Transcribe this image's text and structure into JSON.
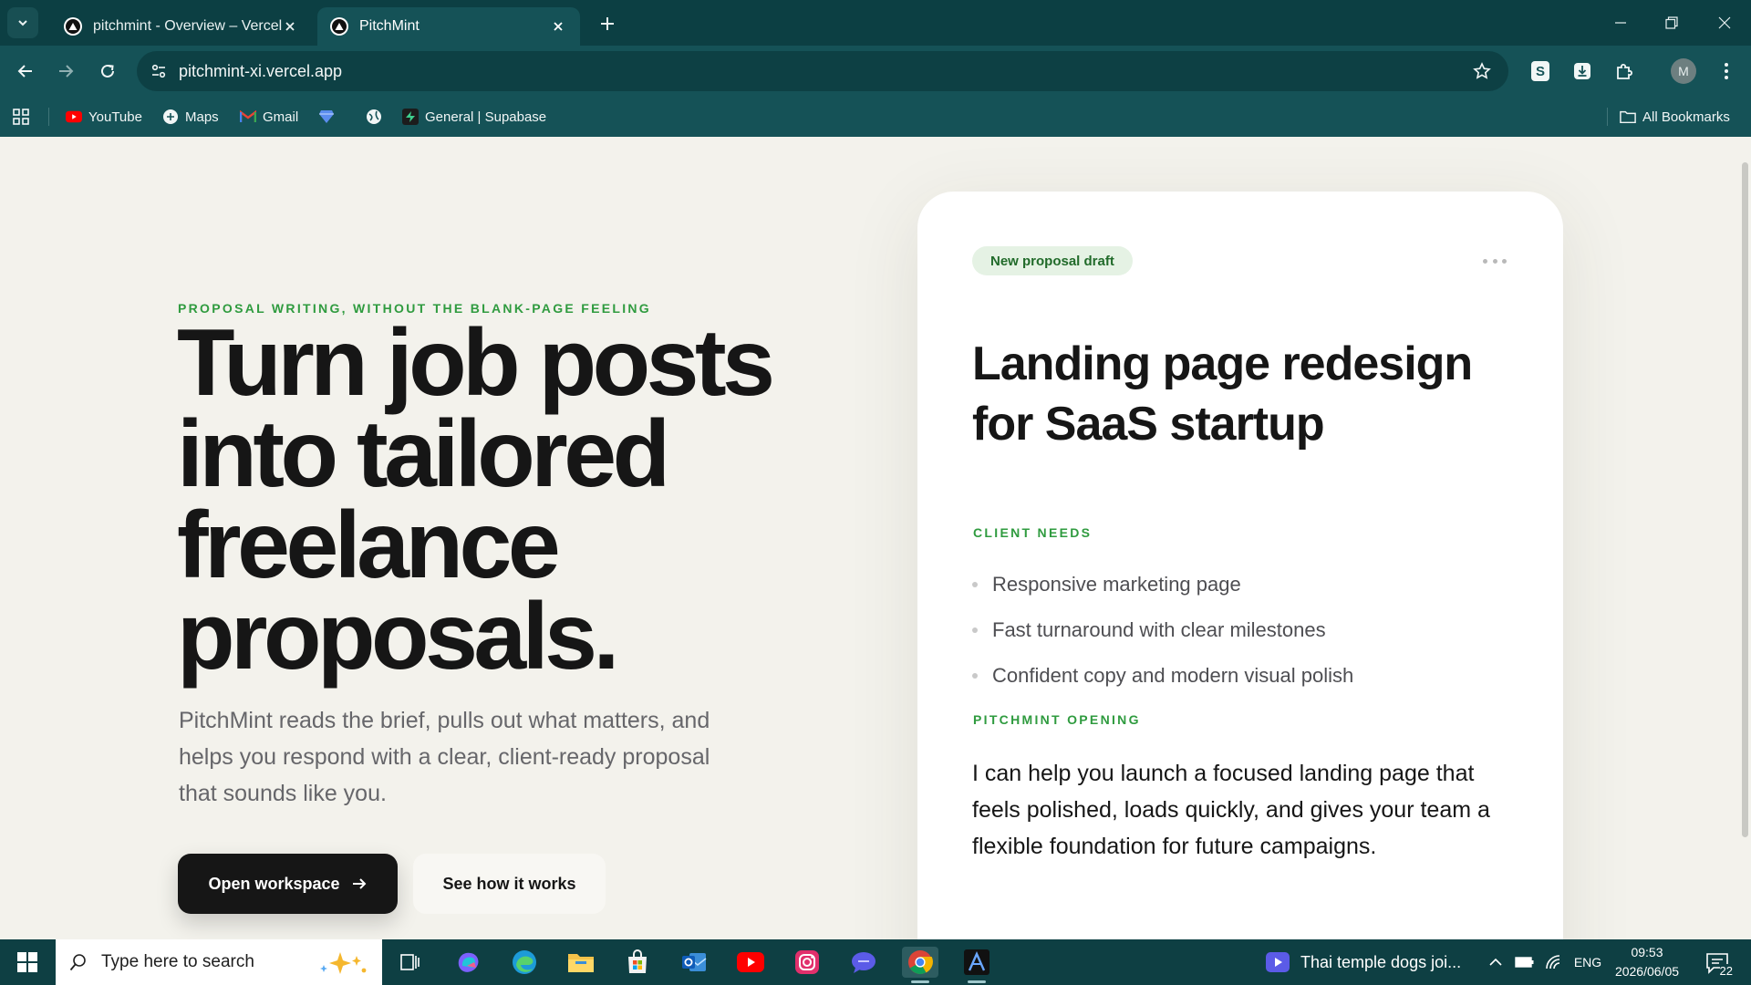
{
  "browser": {
    "tabs": [
      {
        "title": "pitchmint - Overview – Vercel",
        "active": false
      },
      {
        "title": "PitchMint",
        "active": true
      }
    ],
    "url": "pitchmint-xi.vercel.app",
    "profile_initial": "M",
    "bookmarks": [
      {
        "label": "YouTube",
        "icon": "youtube-icon"
      },
      {
        "label": "Maps",
        "icon": "maps-icon"
      },
      {
        "label": "Gmail",
        "icon": "gmail-icon"
      },
      {
        "label": "",
        "icon": "blue-gem-icon"
      },
      {
        "label": "",
        "icon": "globe-icon"
      },
      {
        "label": "General | Supabase",
        "icon": "supabase-icon"
      }
    ],
    "all_bookmarks_label": "All Bookmarks"
  },
  "hero": {
    "eyebrow": "PROPOSAL WRITING, WITHOUT THE BLANK-PAGE FEELING",
    "headline": "Turn job posts into tailored freelance proposals.",
    "lede": "PitchMint reads the brief, pulls out what matters, and helps you respond with a clear, client-ready proposal that sounds like you.",
    "primary_cta": "Open workspace",
    "secondary_cta": "See how it works"
  },
  "card": {
    "badge": "New proposal draft",
    "title": "Landing page redesign for SaaS startup",
    "needs_label": "CLIENT NEEDS",
    "needs": [
      "Responsive marketing page",
      "Fast turnaround with clear milestones",
      "Confident copy and modern visual polish"
    ],
    "opening_label": "PITCHMINT OPENING",
    "opening": "I can help you launch a focused landing page that feels polished, loads quickly, and gives your team a flexible foundation for future campaigns."
  },
  "taskbar": {
    "search_placeholder": "Type here to search",
    "news": "Thai temple dogs joi...",
    "language": "ENG",
    "time": "09:53",
    "date": "2026/06/05",
    "notification_count": "22"
  },
  "colors": {
    "chrome_dark": "#0c3f43",
    "chrome": "#155257",
    "page_bg": "#f3f2ec",
    "accent_green": "#2f9b3f",
    "ink": "#161616"
  }
}
